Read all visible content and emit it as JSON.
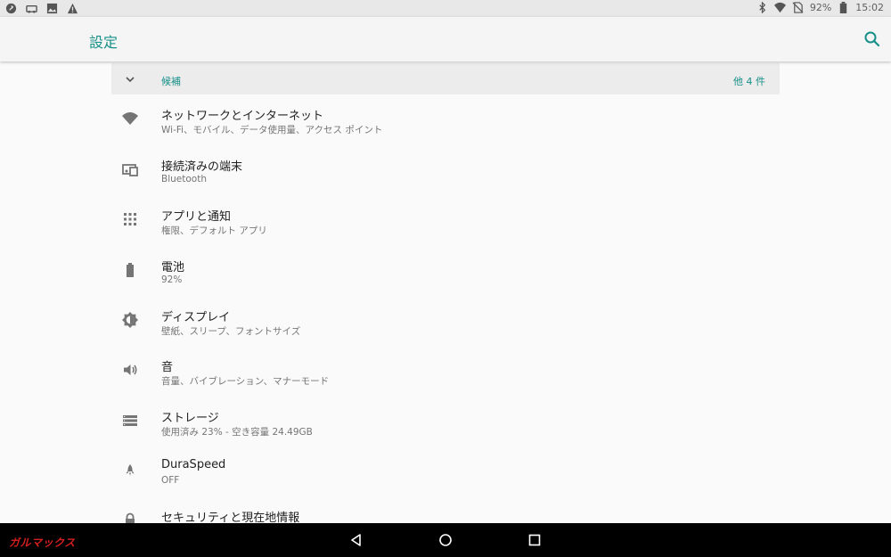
{
  "status_bar": {
    "left_icons": [
      "app-badge-icon",
      "car-icon",
      "image-icon",
      "warning-icon"
    ],
    "battery_percent": "92%",
    "time": "15:02",
    "right_icons": [
      "bluetooth-icon",
      "wifi-icon",
      "no-sim-icon",
      "battery-icon"
    ]
  },
  "app_bar": {
    "title": "設定",
    "search_icon": "search-icon"
  },
  "suggestions": {
    "label": "候補",
    "count": "他 4 件"
  },
  "settings_items": [
    {
      "icon": "wifi-icon",
      "title": "ネットワークとインターネット",
      "subtitle": "Wi-Fi、モバイル、データ使用量、アクセス ポイント"
    },
    {
      "icon": "connected-devices-icon",
      "title": "接続済みの端末",
      "subtitle": "Bluetooth"
    },
    {
      "icon": "apps-grid-icon",
      "title": "アプリと通知",
      "subtitle": "権限、デフォルト アプリ"
    },
    {
      "icon": "battery-icon",
      "title": "電池",
      "subtitle": "92%"
    },
    {
      "icon": "brightness-icon",
      "title": "ディスプレイ",
      "subtitle": "壁紙、スリープ、フォントサイズ"
    },
    {
      "icon": "volume-icon",
      "title": "音",
      "subtitle": "音量、バイブレーション、マナーモード"
    },
    {
      "icon": "storage-icon",
      "title": "ストレージ",
      "subtitle": "使用済み 23% - 空き容量 24.49GB"
    },
    {
      "icon": "rocket-icon",
      "title": "DuraSpeed",
      "subtitle": "OFF"
    },
    {
      "icon": "lock-icon",
      "title": "セキュリティと現在地情報",
      "subtitle": ""
    }
  ],
  "nav_bar": {
    "back": "back-icon",
    "home": "home-icon",
    "recents": "recents-icon"
  },
  "watermark": "ガルマックス",
  "colors": {
    "accent": "#178f88",
    "icon_gray": "#757575",
    "status_bar_bg": "#e8e8e8",
    "watermark_red": "#d41f1f"
  }
}
